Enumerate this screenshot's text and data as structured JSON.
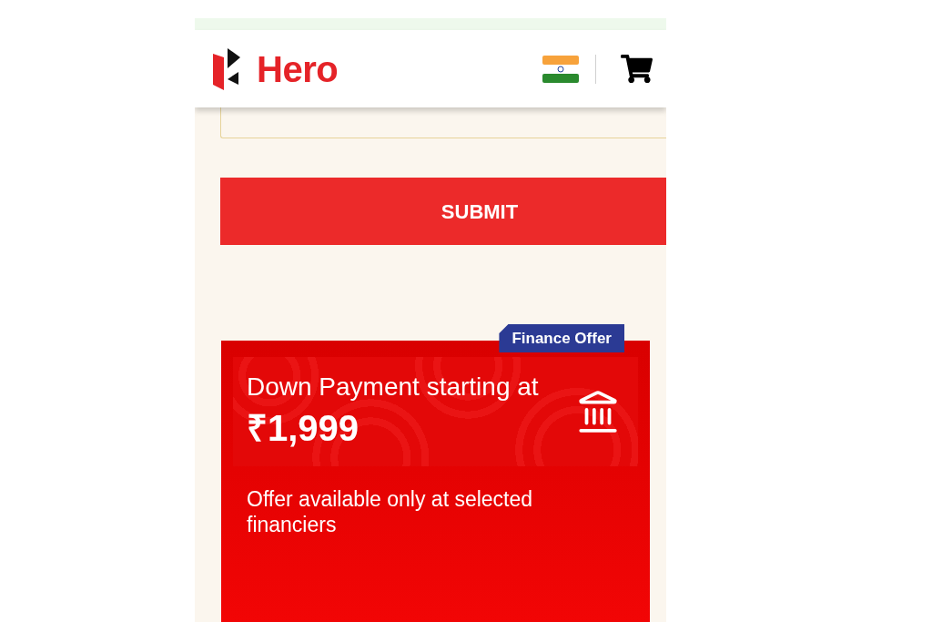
{
  "header": {
    "logo_text": "Hero"
  },
  "submit_button": {
    "label": "SUBMIT"
  },
  "offer_card": {
    "badge": "Finance Offer",
    "heading": "Down Payment starting at",
    "amount": "₹1,999",
    "note": "Offer available only at selected financiers"
  }
}
